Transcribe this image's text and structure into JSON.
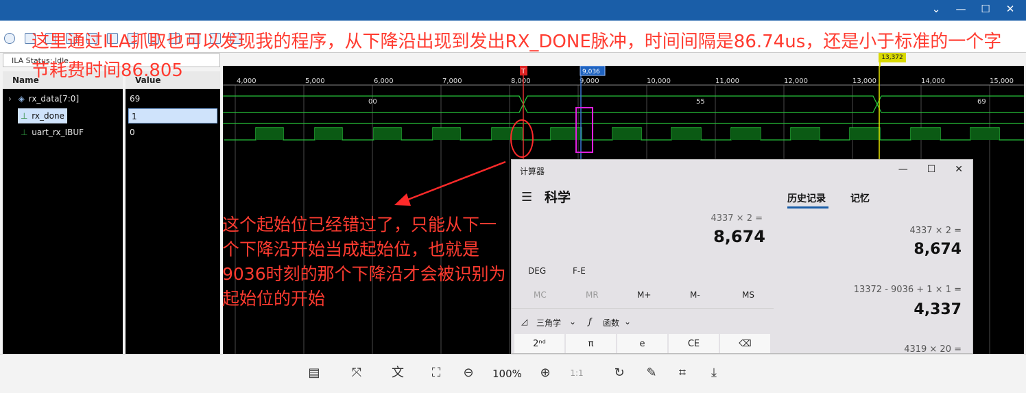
{
  "toolbar": {
    "ila_status": "ILA Status: Idle"
  },
  "signals": {
    "name_header": "Name",
    "value_header": "Value",
    "rows": [
      {
        "name": "rx_data[7:0]",
        "value": "69"
      },
      {
        "name": "rx_done",
        "value": "1"
      },
      {
        "name": "uart_rx_IBUF",
        "value": "0"
      }
    ]
  },
  "waveform": {
    "ruler": [
      "4,000",
      "5,000",
      "6,000",
      "7,000",
      "8,000",
      "9,000",
      "10,000",
      "11,000",
      "12,000",
      "13,000",
      "14,000",
      "15,000"
    ],
    "markers": {
      "t_label": "T",
      "cursor1": "9,036",
      "cursor2": "13,372"
    },
    "bus_values": [
      "00",
      "55",
      "69"
    ]
  },
  "annotations": {
    "top": "这里通过ILA抓取也可以发现我的程序，从下降沿出现到发出RX_DONE脉冲，时间间隔是86.74us，还是小于标准的一个字节耗费时间86.805",
    "mid": "这个起始位已经错过了，只能从下一个下降沿开始当成起始位，也就是9036时刻的那个下降沿才会被识别为起始位的开始"
  },
  "calculator": {
    "window_title": "计算器",
    "mode": "科学",
    "expression": "4337 × 2 =",
    "result": "8,674",
    "deg": "DEG",
    "fe": "F-E",
    "memory": [
      "MC",
      "MR",
      "M+",
      "M-",
      "MS"
    ],
    "trig": "三角学",
    "func": "函数",
    "keys": [
      "2ⁿᵈ",
      "π",
      "e",
      "CE",
      "⌫"
    ],
    "tabs": {
      "history": "历史记录",
      "memory": "记忆"
    },
    "history": [
      {
        "expr": "4337  ×  2 =",
        "result": "8,674"
      },
      {
        "expr": "13372  -  9036  +  1  ×  1 =",
        "result": "4,337"
      },
      {
        "expr": "4319  ×  20 =",
        "result": ""
      }
    ]
  },
  "viewer": {
    "zoom": "100%"
  }
}
